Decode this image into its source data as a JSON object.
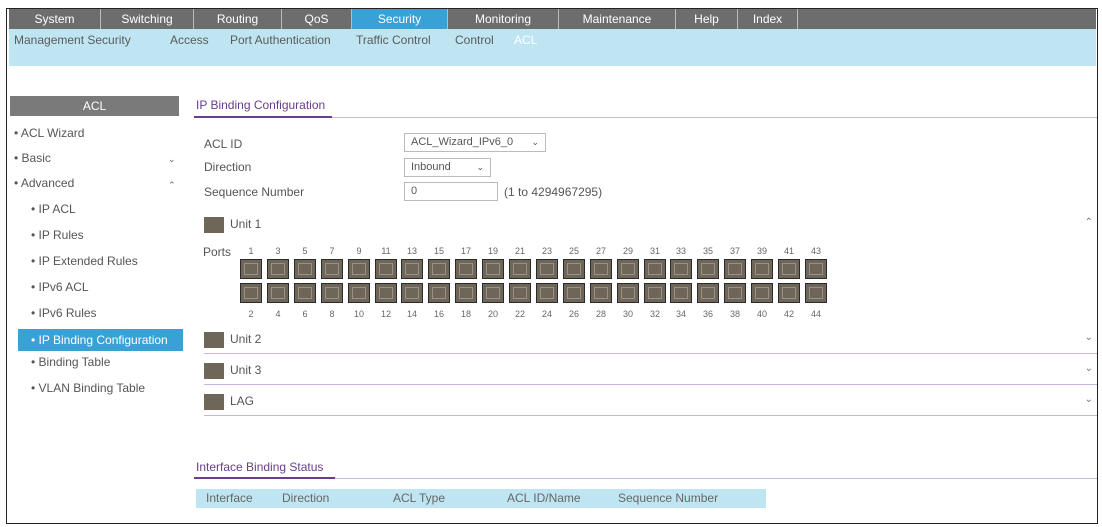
{
  "top_nav": [
    {
      "label": "System",
      "active": false
    },
    {
      "label": "Switching",
      "active": false
    },
    {
      "label": "Routing",
      "active": false
    },
    {
      "label": "QoS",
      "active": false
    },
    {
      "label": "Security",
      "active": true
    },
    {
      "label": "Monitoring",
      "active": false
    },
    {
      "label": "Maintenance",
      "active": false
    },
    {
      "label": "Help",
      "active": false
    },
    {
      "label": "Index",
      "active": false
    }
  ],
  "sub_nav": [
    {
      "label": "Management Security",
      "active": false
    },
    {
      "label": "Access",
      "active": false
    },
    {
      "label": "Port Authentication",
      "active": false
    },
    {
      "label": "Traffic Control",
      "active": false
    },
    {
      "label": "Control",
      "active": false
    },
    {
      "label": "ACL",
      "active": true
    }
  ],
  "sidebar": {
    "title": "ACL",
    "items": [
      {
        "label": "• ACL Wizard"
      },
      {
        "label": "• Basic"
      },
      {
        "label": "• Advanced"
      },
      {
        "label": "• IP ACL"
      },
      {
        "label": "• IP Rules"
      },
      {
        "label": "• IP Extended Rules"
      },
      {
        "label": "• IPv6 ACL"
      },
      {
        "label": "• IPv6 Rules"
      },
      {
        "label": "• IP Binding Configuration",
        "active": true
      },
      {
        "label": "• Binding Table"
      },
      {
        "label": "• VLAN Binding Table"
      }
    ]
  },
  "binding_config": {
    "title": "IP Binding Configuration",
    "acl_id_label": "ACL ID",
    "acl_id_value": "ACL_Wizard_IPv6_0",
    "direction_label": "Direction",
    "direction_value": "Inbound",
    "seq_label": "Sequence Number",
    "seq_value": "0",
    "seq_hint": "(1 to 4294967295)"
  },
  "units": [
    {
      "name": "Unit 1",
      "expanded": true
    },
    {
      "name": "Unit 2",
      "expanded": false
    },
    {
      "name": "Unit 3",
      "expanded": false
    },
    {
      "name": "LAG",
      "expanded": false
    }
  ],
  "ports": {
    "label": "Ports",
    "top": [
      "1",
      "3",
      "5",
      "7",
      "9",
      "11",
      "13",
      "15",
      "17",
      "19",
      "21",
      "23",
      "25",
      "27",
      "29",
      "31",
      "33",
      "35",
      "37",
      "39",
      "41",
      "43"
    ],
    "bottom": [
      "2",
      "4",
      "6",
      "8",
      "10",
      "12",
      "14",
      "16",
      "18",
      "20",
      "22",
      "24",
      "26",
      "28",
      "30",
      "32",
      "34",
      "36",
      "38",
      "40",
      "42",
      "44"
    ]
  },
  "interface_status": {
    "title": "Interface Binding Status",
    "columns": [
      "Interface",
      "Direction",
      "ACL Type",
      "ACL ID/Name",
      "Sequence Number"
    ]
  }
}
